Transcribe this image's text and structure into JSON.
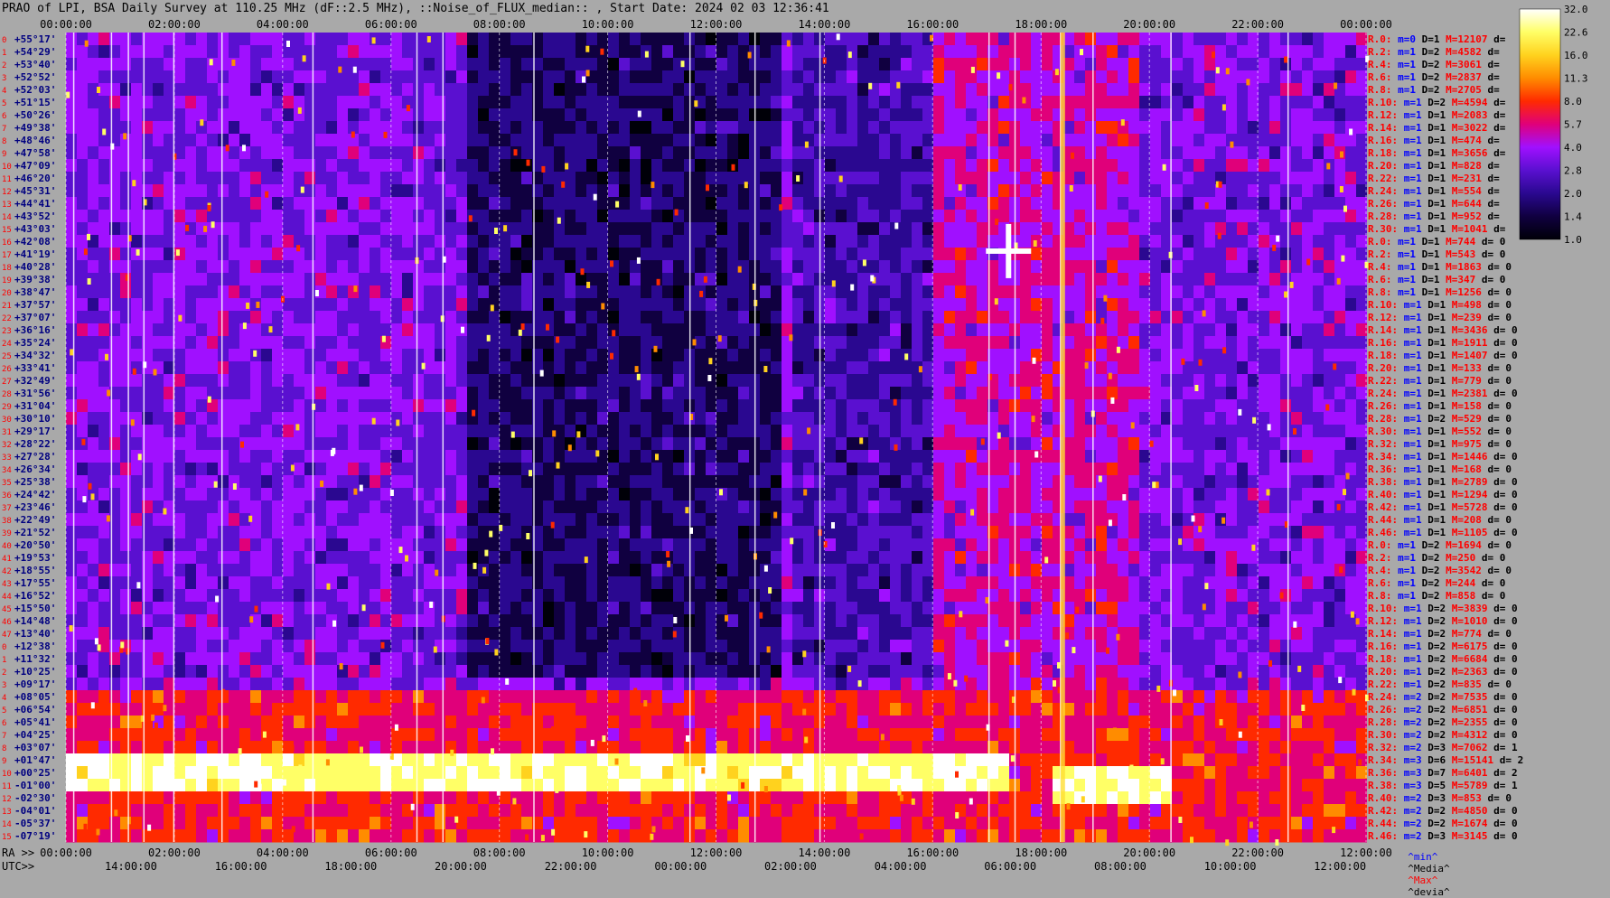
{
  "title": "PRAO of LPI, BSA Daily Survey at 110.25 MHz (dF::2.5 MHz), ::Noise_of_FLUX_median:: , Start Date: 2024 02 03 12:36:41",
  "chart_data": {
    "type": "heatmap",
    "top_axis_labels": [
      "00:00:00",
      "02:00:00",
      "04:00:00",
      "06:00:00",
      "08:00:00",
      "10:00:00",
      "12:00:00",
      "14:00:00",
      "16:00:00",
      "18:00:00",
      "20:00:00",
      "22:00:00",
      "00:00:00"
    ],
    "bottom_ra_prefix": "RA >>",
    "bottom_ra_labels": [
      "00:00:00",
      "02:00:00",
      "04:00:00",
      "06:00:00",
      "08:00:00",
      "10:00:00",
      "12:00:00",
      "14:00:00",
      "16:00:00",
      "18:00:00",
      "20:00:00",
      "22:00:00",
      "12:00:00"
    ],
    "bottom_utc_prefix": "UTC>>",
    "bottom_utc_labels": [
      "14:00:00",
      "16:00:00",
      "18:00:00",
      "20:00:00",
      "22:00:00",
      "00:00:00",
      "02:00:00",
      "04:00:00",
      "06:00:00",
      "08:00:00",
      "10:00:00",
      "12:00:00"
    ],
    "declinations": [
      "+55°17'",
      "+54°29'",
      "+53°40'",
      "+52°52'",
      "+52°03'",
      "+51°15'",
      "+50°26'",
      "+49°38'",
      "+48°46'",
      "+47°58'",
      "+47°09'",
      "+46°20'",
      "+45°31'",
      "+44°41'",
      "+43°52'",
      "+43°03'",
      "+42°08'",
      "+41°19'",
      "+40°28'",
      "+39°38'",
      "+38°47'",
      "+37°57'",
      "+37°07'",
      "+36°16'",
      "+35°24'",
      "+34°32'",
      "+33°41'",
      "+32°49'",
      "+31°56'",
      "+31°04'",
      "+30°10'",
      "+29°17'",
      "+28°22'",
      "+27°28'",
      "+26°34'",
      "+25°38'",
      "+24°42'",
      "+23°46'",
      "+22°49'",
      "+21°52'",
      "+20°50'",
      "+19°53'",
      "+18°55'",
      "+17°55'",
      "+16°52'",
      "+15°50'",
      "+14°48'",
      "+13°40'",
      "+12°38'",
      "+11°32'",
      "+10°25'",
      "+09°17'",
      "+08°05'",
      "+06°54'",
      "+05°41'",
      "+04°25'",
      "+03°07'",
      "+01°47'",
      "+00°25'",
      "-01°00'",
      "-02°30'",
      "-04°01'",
      "-05°37'",
      "-07°19'"
    ],
    "row_stats": [
      [
        "R.0:",
        "m=0 D=1",
        "M=12107",
        "d="
      ],
      [
        "R.2:",
        "m=1 D=2",
        "M=4582",
        "d="
      ],
      [
        "R.4:",
        "m=1 D=2",
        "M=3061",
        "d="
      ],
      [
        "R.6:",
        "m=1 D=2",
        "M=2837",
        "d="
      ],
      [
        "R.8:",
        "m=1 D=2",
        "M=2705",
        "d="
      ],
      [
        "R.10:",
        "m=1 D=2",
        "M=4594",
        "d="
      ],
      [
        "R.12:",
        "m=1 D=1",
        "M=2083",
        "d="
      ],
      [
        "R.14:",
        "m=1 D=1",
        "M=3022",
        "d="
      ],
      [
        "R.16:",
        "m=1 D=1",
        "M=474",
        "d="
      ],
      [
        "R.18:",
        "m=1 D=1",
        "M=3656",
        "d="
      ],
      [
        "R.20:",
        "m=1 D=1",
        "M=828",
        "d="
      ],
      [
        "R.22:",
        "m=1 D=1",
        "M=231",
        "d="
      ],
      [
        "R.24:",
        "m=1 D=1",
        "M=554",
        "d="
      ],
      [
        "R.26:",
        "m=1 D=1",
        "M=644",
        "d="
      ],
      [
        "R.28:",
        "m=1 D=1",
        "M=952",
        "d="
      ],
      [
        "R.30:",
        "m=1 D=1",
        "M=1041",
        "d="
      ],
      [
        "R.0:",
        "m=1 D=1",
        "M=744",
        "d= 0"
      ],
      [
        "R.2:",
        "m=1 D=1",
        "M=543",
        "d= 0"
      ],
      [
        "R.4:",
        "m=1 D=1",
        "M=1863",
        "d= 0"
      ],
      [
        "R.6:",
        "m=1 D=1",
        "M=347",
        "d= 0"
      ],
      [
        "R.8:",
        "m=1 D=1",
        "M=1256",
        "d= 0"
      ],
      [
        "R.10:",
        "m=1 D=1",
        "M=498",
        "d= 0"
      ],
      [
        "R.12:",
        "m=1 D=1",
        "M=239",
        "d= 0"
      ],
      [
        "R.14:",
        "m=1 D=1",
        "M=3436",
        "d= 0"
      ],
      [
        "R.16:",
        "m=1 D=1",
        "M=1911",
        "d= 0"
      ],
      [
        "R.18:",
        "m=1 D=1",
        "M=1407",
        "d= 0"
      ],
      [
        "R.20:",
        "m=1 D=1",
        "M=133",
        "d= 0"
      ],
      [
        "R.22:",
        "m=1 D=1",
        "M=779",
        "d= 0"
      ],
      [
        "R.24:",
        "m=1 D=1",
        "M=2381",
        "d= 0"
      ],
      [
        "R.26:",
        "m=1 D=1",
        "M=158",
        "d= 0"
      ],
      [
        "R.28:",
        "m=1 D=2",
        "M=529",
        "d= 0"
      ],
      [
        "R.30:",
        "m=1 D=1",
        "M=552",
        "d= 0"
      ],
      [
        "R.32:",
        "m=1 D=1",
        "M=975",
        "d= 0"
      ],
      [
        "R.34:",
        "m=1 D=1",
        "M=1446",
        "d= 0"
      ],
      [
        "R.36:",
        "m=1 D=1",
        "M=168",
        "d= 0"
      ],
      [
        "R.38:",
        "m=1 D=1",
        "M=2789",
        "d= 0"
      ],
      [
        "R.40:",
        "m=1 D=1",
        "M=1294",
        "d= 0"
      ],
      [
        "R.42:",
        "m=1 D=1",
        "M=5728",
        "d= 0"
      ],
      [
        "R.44:",
        "m=1 D=1",
        "M=208",
        "d= 0"
      ],
      [
        "R.46:",
        "m=1 D=1",
        "M=1105",
        "d= 0"
      ],
      [
        "R.0:",
        "m=1 D=2",
        "M=1694",
        "d= 0"
      ],
      [
        "R.2:",
        "m=1 D=2",
        "M=250",
        "d= 0"
      ],
      [
        "R.4:",
        "m=1 D=2",
        "M=3542",
        "d= 0"
      ],
      [
        "R.6:",
        "m=1 D=2",
        "M=244",
        "d= 0"
      ],
      [
        "R.8:",
        "m=1 D=2",
        "M=858",
        "d= 0"
      ],
      [
        "R.10:",
        "m=1 D=2",
        "M=3839",
        "d= 0"
      ],
      [
        "R.12:",
        "m=1 D=2",
        "M=1010",
        "d= 0"
      ],
      [
        "R.14:",
        "m=1 D=2",
        "M=774",
        "d= 0"
      ],
      [
        "R.16:",
        "m=1 D=2",
        "M=6175",
        "d= 0"
      ],
      [
        "R.18:",
        "m=1 D=2",
        "M=6684",
        "d= 0"
      ],
      [
        "R.20:",
        "m=1 D=2",
        "M=2363",
        "d= 0"
      ],
      [
        "R.22:",
        "m=1 D=2",
        "M=835",
        "d= 0"
      ],
      [
        "R.24:",
        "m=2 D=2",
        "M=7535",
        "d= 0"
      ],
      [
        "R.26:",
        "m=2 D=2",
        "M=6851",
        "d= 0"
      ],
      [
        "R.28:",
        "m=2 D=2",
        "M=2355",
        "d= 0"
      ],
      [
        "R.30:",
        "m=2 D=2",
        "M=4312",
        "d= 0"
      ],
      [
        "R.32:",
        "m=2 D=3",
        "M=7062",
        "d= 1"
      ],
      [
        "R.34:",
        "m=3 D=6",
        "M=15141",
        "d= 2"
      ],
      [
        "R.36:",
        "m=3 D=7",
        "M=6401",
        "d= 2"
      ],
      [
        "R.38:",
        "m=3 D=5",
        "M=5789",
        "d= 1"
      ],
      [
        "R.40:",
        "m=2 D=3",
        "M=853",
        "d= 0"
      ],
      [
        "R.42:",
        "m=2 D=2",
        "M=4850",
        "d= 0"
      ],
      [
        "R.44:",
        "m=2 D=2",
        "M=1674",
        "d= 0"
      ],
      [
        "R.46:",
        "m=2 D=3",
        "M=3145",
        "d= 0"
      ]
    ],
    "colorbar_ticks": [
      "32.0",
      "22.6",
      "16.0",
      "11.3",
      "8.0",
      "5.7",
      "4.0",
      "2.8",
      "2.0",
      "1.4",
      "1.0"
    ],
    "colorbar_colors": [
      "#ffffff",
      "#ffff66",
      "#ffd21e",
      "#ff8c00",
      "#ff2a00",
      "#e0007a",
      "#a010ff",
      "#5a10d0",
      "#2a0890",
      "#100040",
      "#000008"
    ],
    "footer_labels": [
      "^min^",
      "^Media^",
      "^Max^",
      "^devia^"
    ],
    "footer_colors": [
      "#0000ff",
      "#000000",
      "#ff0000",
      "#000000"
    ],
    "colors": {
      "background": "#a9a9a9",
      "sky_base": "#3a10a0",
      "sky_dark": "#0c0430",
      "stat_row_index": "#ff0000",
      "stat_m": "#0000ff",
      "stat_D": "#000000",
      "stat_M": "#ff0000",
      "stat_d": "#000000",
      "left_index": "#ff0000",
      "dec_text": "#000080"
    }
  }
}
